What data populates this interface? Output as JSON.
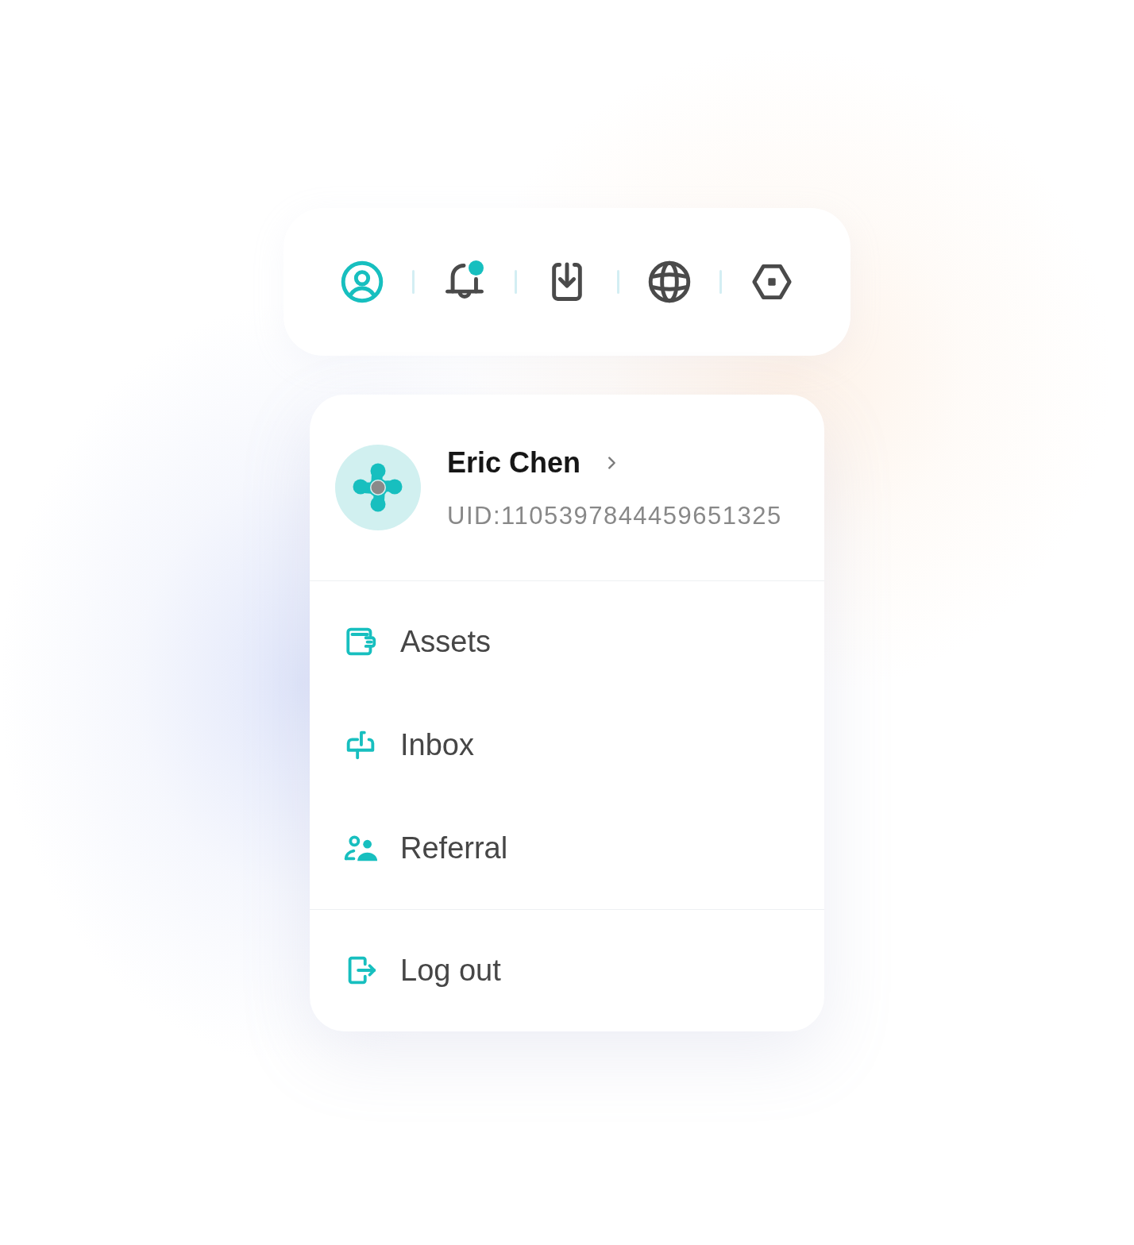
{
  "toolbar": {
    "items": [
      {
        "kind": "account",
        "selected": true,
        "unread": false
      },
      {
        "kind": "notifications",
        "selected": false,
        "unread": true
      },
      {
        "kind": "download",
        "selected": false,
        "unread": false
      },
      {
        "kind": "language",
        "selected": false,
        "unread": false
      },
      {
        "kind": "settings",
        "selected": false,
        "unread": false
      }
    ]
  },
  "profile": {
    "name": "Eric Chen",
    "uid": "UID:1105397844459651325"
  },
  "menu": {
    "sections": [
      {
        "items": [
          {
            "kind": "assets",
            "label": "Assets"
          },
          {
            "kind": "inbox",
            "label": "Inbox"
          },
          {
            "kind": "referral",
            "label": "Referral"
          }
        ]
      },
      {
        "items": [
          {
            "kind": "logout",
            "label": "Log out"
          }
        ]
      }
    ]
  }
}
